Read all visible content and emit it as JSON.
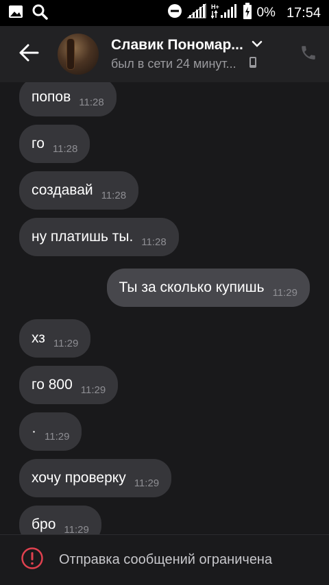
{
  "status_bar": {
    "battery": "0%",
    "time": "17:54"
  },
  "header": {
    "name": "Славик Пономар...",
    "status": "был в сети 24 минут..."
  },
  "messages": [
    {
      "text": "попов",
      "time": "11:28",
      "direction": "in"
    },
    {
      "text": "го",
      "time": "11:28",
      "direction": "in"
    },
    {
      "text": "создавай",
      "time": "11:28",
      "direction": "in"
    },
    {
      "text": "ну платишь ты.",
      "time": "11:28",
      "direction": "in"
    },
    {
      "text": "Ты за сколько купишь",
      "time": "11:29",
      "direction": "out"
    },
    {
      "text": "хз",
      "time": "11:29",
      "direction": "in"
    },
    {
      "text": "го 800",
      "time": "11:29",
      "direction": "in"
    },
    {
      "text": "·",
      "time": "11:29",
      "direction": "in"
    },
    {
      "text": "хочу проверку",
      "time": "11:29",
      "direction": "in"
    },
    {
      "text": "бро",
      "time": "11:29",
      "direction": "in"
    }
  ],
  "footer": {
    "text": "Отправка сообщений ограничена"
  },
  "icons": {
    "status_bar": [
      "image-icon",
      "search-icon",
      "do-not-disturb-icon",
      "signal-icon",
      "signal-h-plus-icon",
      "battery-charging-icon"
    ],
    "header": [
      "back-arrow-icon",
      "chevron-down-icon",
      "mobile-device-icon",
      "phone-icon"
    ],
    "footer": [
      "warning-icon"
    ]
  },
  "colors": {
    "background": "#19191b",
    "bubble": "#36363a",
    "header": "#222224",
    "warning": "#e0414f"
  }
}
